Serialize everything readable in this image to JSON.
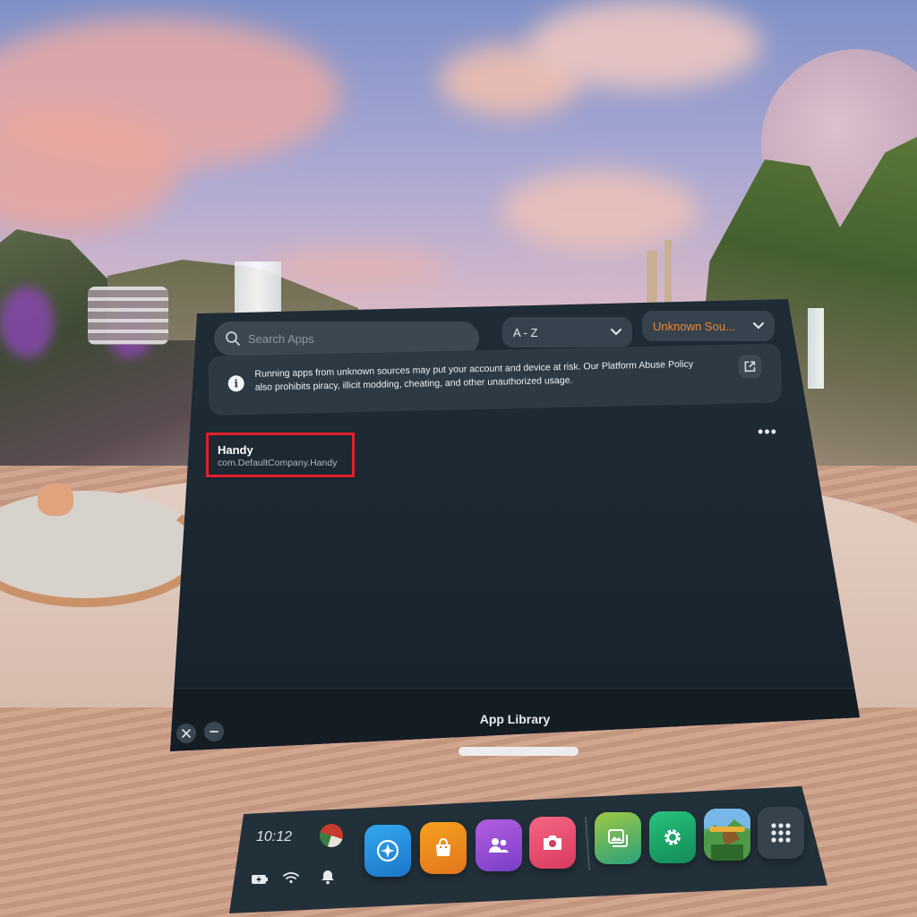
{
  "search": {
    "placeholder": "Search Apps"
  },
  "filters": {
    "sort_value": "A - Z",
    "source_value": "Unknown Sou...",
    "accent_color": "#f0872e"
  },
  "warning": {
    "message": "Running apps from unknown sources may put your account and device at risk. Our Platform Abuse Policy also prohibits piracy, illicit modding, cheating, and other unauthorized usage."
  },
  "apps": [
    {
      "name": "Handy",
      "package": "com.DefaultCompany.Handy"
    }
  ],
  "panel": {
    "title": "App Library"
  },
  "dock": {
    "time": "10:12",
    "status_icons": [
      "battery-icon",
      "wifi-icon",
      "bell-icon"
    ],
    "apps": [
      "explore-icon",
      "store-icon",
      "people-icon",
      "camera-icon",
      "gallery-icon",
      "settings-icon",
      "game-icon",
      "app-library-grid-icon"
    ]
  },
  "colors": {
    "highlight_box": "#e0202a"
  }
}
